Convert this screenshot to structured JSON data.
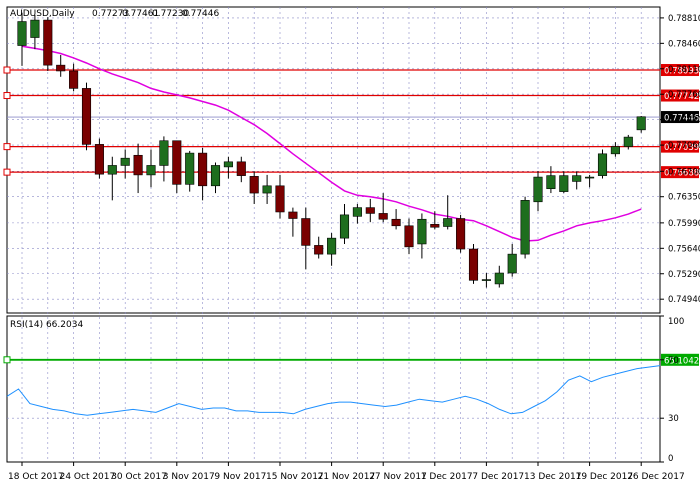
{
  "chart_data": [
    {
      "type": "candlestick",
      "title": "AUDUSD,Daily",
      "ohlc_header": [
        "0.77273",
        "0.77461",
        "0.77230",
        "0.77446"
      ],
      "ylim": [
        0.7475,
        0.7896
      ],
      "y_ticks": [
        "0.78810",
        "0.78460",
        "0.78110",
        "0.77760",
        "0.77410",
        "0.77060",
        "0.76700",
        "0.76350",
        "0.75990",
        "0.75640",
        "0.75290",
        "0.74940"
      ],
      "x_tick_labels": [
        "18 Oct 2017",
        "24 Oct 2017",
        "30 Oct 2017",
        "3 Nov 2017",
        "9 Nov 2017",
        "15 Nov 2017",
        "21 Nov 2017",
        "27 Nov 2017",
        "1 Dec 2017",
        "7 Dec 2017",
        "13 Dec 2017",
        "19 Dec 2017",
        "26 Dec 2017"
      ],
      "x_tick_index": [
        0,
        4,
        8,
        12,
        16,
        20,
        24,
        28,
        32,
        36,
        40,
        44,
        48
      ],
      "candles": [
        {
          "o": 0.7843,
          "h": 0.7888,
          "l": 0.7815,
          "c": 0.7876
        },
        {
          "o": 0.7854,
          "h": 0.7885,
          "l": 0.7838,
          "c": 0.7878
        },
        {
          "o": 0.7878,
          "h": 0.7882,
          "l": 0.7808,
          "c": 0.7816
        },
        {
          "o": 0.7816,
          "h": 0.783,
          "l": 0.78,
          "c": 0.7808
        },
        {
          "o": 0.7808,
          "h": 0.7818,
          "l": 0.778,
          "c": 0.7784
        },
        {
          "o": 0.7784,
          "h": 0.7792,
          "l": 0.7699,
          "c": 0.7707
        },
        {
          "o": 0.7707,
          "h": 0.7715,
          "l": 0.766,
          "c": 0.7666
        },
        {
          "o": 0.7666,
          "h": 0.769,
          "l": 0.763,
          "c": 0.7678
        },
        {
          "o": 0.7678,
          "h": 0.77,
          "l": 0.766,
          "c": 0.7688
        },
        {
          "o": 0.7692,
          "h": 0.7708,
          "l": 0.764,
          "c": 0.7665
        },
        {
          "o": 0.7665,
          "h": 0.77,
          "l": 0.7648,
          "c": 0.7678
        },
        {
          "o": 0.7678,
          "h": 0.7718,
          "l": 0.7656,
          "c": 0.7712
        },
        {
          "o": 0.7712,
          "h": 0.7712,
          "l": 0.764,
          "c": 0.7652
        },
        {
          "o": 0.7652,
          "h": 0.7698,
          "l": 0.7642,
          "c": 0.7695
        },
        {
          "o": 0.7695,
          "h": 0.7702,
          "l": 0.763,
          "c": 0.765
        },
        {
          "o": 0.765,
          "h": 0.7682,
          "l": 0.764,
          "c": 0.7678
        },
        {
          "o": 0.7676,
          "h": 0.769,
          "l": 0.766,
          "c": 0.7683
        },
        {
          "o": 0.7683,
          "h": 0.769,
          "l": 0.7655,
          "c": 0.7664
        },
        {
          "o": 0.7663,
          "h": 0.767,
          "l": 0.7625,
          "c": 0.764
        },
        {
          "o": 0.764,
          "h": 0.7665,
          "l": 0.7625,
          "c": 0.765
        },
        {
          "o": 0.765,
          "h": 0.7665,
          "l": 0.7605,
          "c": 0.7614
        },
        {
          "o": 0.7614,
          "h": 0.762,
          "l": 0.758,
          "c": 0.7605
        },
        {
          "o": 0.7605,
          "h": 0.762,
          "l": 0.7535,
          "c": 0.7568
        },
        {
          "o": 0.7568,
          "h": 0.758,
          "l": 0.755,
          "c": 0.7556
        },
        {
          "o": 0.7556,
          "h": 0.7585,
          "l": 0.754,
          "c": 0.7578
        },
        {
          "o": 0.7578,
          "h": 0.7625,
          "l": 0.757,
          "c": 0.761
        },
        {
          "o": 0.7608,
          "h": 0.7625,
          "l": 0.7598,
          "c": 0.762
        },
        {
          "o": 0.762,
          "h": 0.7632,
          "l": 0.76,
          "c": 0.7612
        },
        {
          "o": 0.7612,
          "h": 0.764,
          "l": 0.76,
          "c": 0.7604
        },
        {
          "o": 0.7604,
          "h": 0.7618,
          "l": 0.759,
          "c": 0.7595
        },
        {
          "o": 0.7595,
          "h": 0.7605,
          "l": 0.7556,
          "c": 0.7566
        },
        {
          "o": 0.757,
          "h": 0.7612,
          "l": 0.755,
          "c": 0.7604
        },
        {
          "o": 0.7597,
          "h": 0.7615,
          "l": 0.759,
          "c": 0.7593
        },
        {
          "o": 0.7594,
          "h": 0.7637,
          "l": 0.759,
          "c": 0.7605
        },
        {
          "o": 0.7605,
          "h": 0.761,
          "l": 0.7558,
          "c": 0.7563
        },
        {
          "o": 0.7563,
          "h": 0.757,
          "l": 0.7515,
          "c": 0.752
        },
        {
          "o": 0.752,
          "h": 0.753,
          "l": 0.751,
          "c": 0.7521
        },
        {
          "o": 0.7515,
          "h": 0.754,
          "l": 0.751,
          "c": 0.753
        },
        {
          "o": 0.753,
          "h": 0.757,
          "l": 0.7525,
          "c": 0.7556
        },
        {
          "o": 0.7556,
          "h": 0.7635,
          "l": 0.755,
          "c": 0.763
        },
        {
          "o": 0.7628,
          "h": 0.767,
          "l": 0.7615,
          "c": 0.7662
        },
        {
          "o": 0.7646,
          "h": 0.7677,
          "l": 0.764,
          "c": 0.7664
        },
        {
          "o": 0.7642,
          "h": 0.767,
          "l": 0.764,
          "c": 0.7664
        },
        {
          "o": 0.7656,
          "h": 0.767,
          "l": 0.7645,
          "c": 0.7664
        },
        {
          "o": 0.7662,
          "h": 0.7665,
          "l": 0.7648,
          "c": 0.7662
        },
        {
          "o": 0.7664,
          "h": 0.77,
          "l": 0.766,
          "c": 0.7694
        },
        {
          "o": 0.7694,
          "h": 0.771,
          "l": 0.769,
          "c": 0.7704
        },
        {
          "o": 0.7704,
          "h": 0.772,
          "l": 0.77,
          "c": 0.7717
        },
        {
          "o": 0.7727,
          "h": 0.7746,
          "l": 0.7723,
          "c": 0.7745
        }
      ],
      "moving_average": [
        0.7842,
        0.7839,
        0.7836,
        0.7832,
        0.7826,
        0.7819,
        0.7811,
        0.7804,
        0.7798,
        0.7792,
        0.7784,
        0.7779,
        0.7775,
        0.7771,
        0.7766,
        0.7761,
        0.7754,
        0.7744,
        0.7734,
        0.7722,
        0.7708,
        0.7694,
        0.7681,
        0.7668,
        0.7655,
        0.7643,
        0.7637,
        0.7635,
        0.7632,
        0.7628,
        0.7622,
        0.7617,
        0.7611,
        0.7608,
        0.7604,
        0.7602,
        0.7595,
        0.7587,
        0.7579,
        0.7574,
        0.7575,
        0.7582,
        0.7588,
        0.7595,
        0.7599,
        0.7602,
        0.7606,
        0.7611,
        0.7618
      ],
      "levels": [
        {
          "value": 0.78093,
          "label": "0.78093",
          "color": "#e00000"
        },
        {
          "value": 0.77742,
          "label": "0.77742",
          "color": "#e00000"
        },
        {
          "value": 0.77039,
          "label": "0.77039",
          "color": "#e00000"
        },
        {
          "value": 0.76688,
          "label": "0.76688",
          "color": "#e00000"
        }
      ],
      "current_price": {
        "value": 0.77446,
        "label": "0.77446"
      },
      "colors": {
        "bull": "#1e6e1e",
        "bear": "#7a0000",
        "ma": "#e000e0",
        "level": "#e00000",
        "current": "#000000"
      }
    },
    {
      "type": "line",
      "title": "RSI(14) 66.2034",
      "ylim": [
        0,
        100
      ],
      "y_ticks": [
        "100",
        "70",
        "30",
        "0"
      ],
      "level": {
        "value": 70,
        "label": "65.1042",
        "color": "#00aa00"
      },
      "values": [
        45,
        50,
        40,
        38,
        36,
        35,
        33,
        32,
        33,
        34,
        35,
        36,
        35,
        34,
        37,
        40,
        38,
        36,
        37,
        37,
        35,
        35,
        34,
        34,
        34,
        33,
        36,
        38,
        40,
        41,
        41,
        40,
        39,
        38,
        39,
        41,
        43,
        42,
        41,
        43,
        45,
        43,
        40,
        36,
        33,
        34,
        38,
        42,
        48,
        56,
        59,
        55,
        58,
        60,
        62,
        64,
        65,
        66
      ]
    }
  ]
}
